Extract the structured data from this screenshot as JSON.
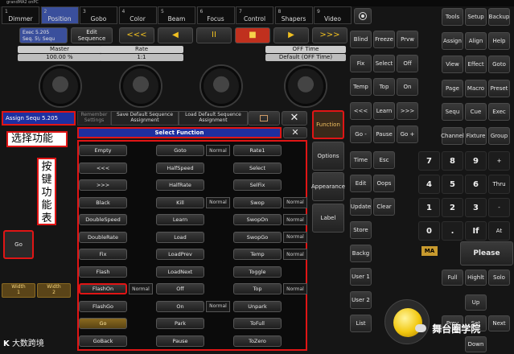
{
  "window_title": "grandMA2 onPC",
  "tabs": [
    {
      "num": "1",
      "label": "Dimmer"
    },
    {
      "num": "2",
      "label": "Position"
    },
    {
      "num": "3",
      "label": "Gobo"
    },
    {
      "num": "4",
      "label": "Color"
    },
    {
      "num": "5",
      "label": "Beam"
    },
    {
      "num": "6",
      "label": "Focus"
    },
    {
      "num": "7",
      "label": "Control"
    },
    {
      "num": "8",
      "label": "Shapers"
    },
    {
      "num": "9",
      "label": "Video"
    }
  ],
  "exec": {
    "line1": "Exec 5.205",
    "line2": "Seq. 5\\: Sequ"
  },
  "edit_sequence": "Edit Sequence",
  "transport": [
    "<<<",
    "◀",
    "II",
    "■",
    "▶",
    ">>>"
  ],
  "master": {
    "label": "Master",
    "value": "100.00 %"
  },
  "rate": {
    "label": "Rate",
    "value": "1:1"
  },
  "off_time": {
    "label": "OFF Time",
    "value": "Default (OFF Time)"
  },
  "assign_bar": {
    "title": "Assign Sequ 5.205",
    "remember": "Remember Settings",
    "save_default": "Save Default Sequence Assignment",
    "load_default": "Load Default Sequence Assignment"
  },
  "annotation_select": "选择功能",
  "annotation_keys": "按键功能表",
  "select_function_title": "Select Function",
  "functions_col1": [
    "Empty",
    "<<<",
    ">>>",
    "Black",
    "DoubleSpeed",
    "DoubleRate",
    "Fix",
    "Flash",
    "FlashOn",
    "FlashGo",
    "Go",
    "GoBack"
  ],
  "functions_col2": [
    "Goto",
    "HalfSpeed",
    "HalfRate",
    "Kill",
    "Learn",
    "Load",
    "LoadPrev",
    "LoadNext",
    "Off",
    "On",
    "Park",
    "Pause"
  ],
  "functions_col3": [
    "Rate1",
    "Select",
    "SelFix",
    "Swop",
    "SwopOn",
    "SwopGo",
    "Temp",
    "Toggle",
    "Top",
    "Unpark",
    "ToFull",
    "ToZero"
  ],
  "normal_label": "Normal",
  "side_menu": [
    "Function",
    "Options",
    "Appearance",
    "Label"
  ],
  "go_button": "Go",
  "width_buttons": [
    {
      "label": "Width",
      "value": "1"
    },
    {
      "label": "Width",
      "value": "2"
    }
  ],
  "mid_keys": [
    [
      "Blind",
      "Freeze",
      "Prvw"
    ],
    [
      "Fix",
      "Select",
      "Off"
    ],
    [
      "Temp",
      "Top",
      "On"
    ],
    [
      "<<<",
      "Learn",
      ">>>"
    ],
    [
      "Go -",
      "Pause",
      "Go +"
    ]
  ],
  "mid_keys2": [
    [
      "Time",
      "Esc"
    ],
    [
      "Edit",
      "Oops"
    ],
    [
      "Update",
      "Clear"
    ],
    [
      "Store"
    ],
    [
      "Backg"
    ],
    [
      "User 1"
    ],
    [
      "User 2"
    ],
    [
      "List"
    ]
  ],
  "right_keys": [
    [
      "Tools",
      "Setup",
      "Backup"
    ],
    [
      "Assign",
      "Align",
      "Help"
    ],
    [
      "View",
      "Effect",
      "Goto"
    ],
    [
      "Page",
      "Macro",
      "Preset"
    ],
    [
      "Sequ",
      "Cue",
      "Exec"
    ],
    [
      "Channel",
      "Fixture",
      "Group"
    ]
  ],
  "numpad": [
    [
      "7",
      "8",
      "9",
      "+"
    ],
    [
      "4",
      "5",
      "6",
      "Thru"
    ],
    [
      "1",
      "2",
      "3",
      "-"
    ],
    [
      "0",
      ".",
      "If",
      "At"
    ]
  ],
  "ma_label": "MA",
  "please": "Please",
  "bottom_right": [
    "Full",
    "Highlt",
    "Solo",
    "Up",
    "Prev",
    "Set",
    "Next",
    "Down"
  ],
  "watermark_left": "大数跨境",
  "watermark_right": "舞台圈学院"
}
